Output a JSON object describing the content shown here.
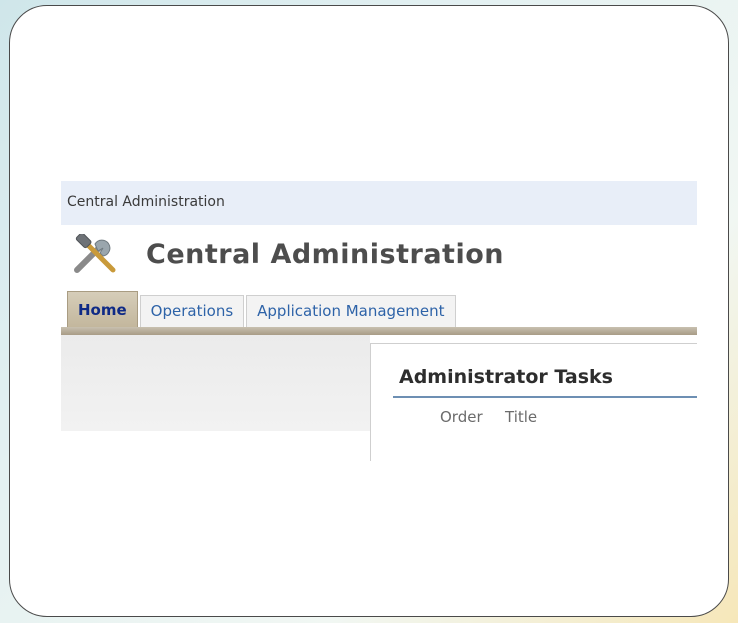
{
  "breadcrumb": "Central Administration",
  "header": {
    "logo_icon": "tools-icon",
    "title": "Central Administration"
  },
  "tabs": [
    {
      "label": "Home",
      "active": true
    },
    {
      "label": "Operations",
      "active": false
    },
    {
      "label": "Application Management",
      "active": false
    }
  ],
  "tasks": {
    "title": "Administrator Tasks",
    "columns": [
      "Order",
      "Title"
    ]
  },
  "colors": {
    "active_tab_text": "#0f2a86",
    "tab_text": "#2e63a8",
    "breadcrumb_bg": "#e8eef8",
    "tasks_rule": "#6d8fb3"
  }
}
